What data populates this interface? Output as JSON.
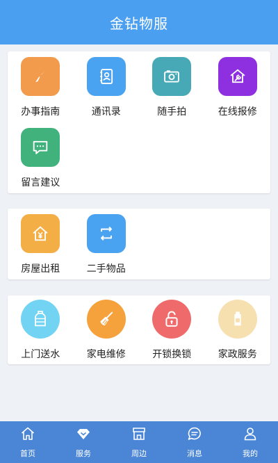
{
  "header": {
    "title": "金钻物服"
  },
  "section1": {
    "items": [
      {
        "label": "办事指南",
        "icon": "compass-icon",
        "color": "#f29b4c"
      },
      {
        "label": "通讯录",
        "icon": "contacts-icon",
        "color": "#4aa3f0"
      },
      {
        "label": "随手拍",
        "icon": "camera-icon",
        "color": "#46a9b5"
      },
      {
        "label": "在线报修",
        "icon": "repair-icon",
        "color": "#8e2fe0"
      },
      {
        "label": "留言建议",
        "icon": "message-icon",
        "color": "#41b27c"
      }
    ]
  },
  "section2": {
    "items": [
      {
        "label": "房屋出租",
        "icon": "house-rent-icon",
        "color": "#f3ae45"
      },
      {
        "label": "二手物品",
        "icon": "exchange-icon",
        "color": "#4aa3f0"
      }
    ]
  },
  "section3": {
    "items": [
      {
        "label": "上门送水",
        "icon": "water-bottle-icon",
        "color": "#72d4f2"
      },
      {
        "label": "家电维修",
        "icon": "broom-icon",
        "color": "#f5a13c"
      },
      {
        "label": "开锁换锁",
        "icon": "unlock-icon",
        "color": "#ef6b6b"
      },
      {
        "label": "家政服务",
        "icon": "housekeeping-icon",
        "color": "#f7e0b0"
      }
    ]
  },
  "tabbar": {
    "tabs": [
      {
        "label": "首页",
        "icon": "home-icon"
      },
      {
        "label": "服务",
        "icon": "service-diamond-icon"
      },
      {
        "label": "周边",
        "icon": "shop-icon"
      },
      {
        "label": "消息",
        "icon": "chat-icon"
      },
      {
        "label": "我的",
        "icon": "user-icon"
      }
    ]
  }
}
